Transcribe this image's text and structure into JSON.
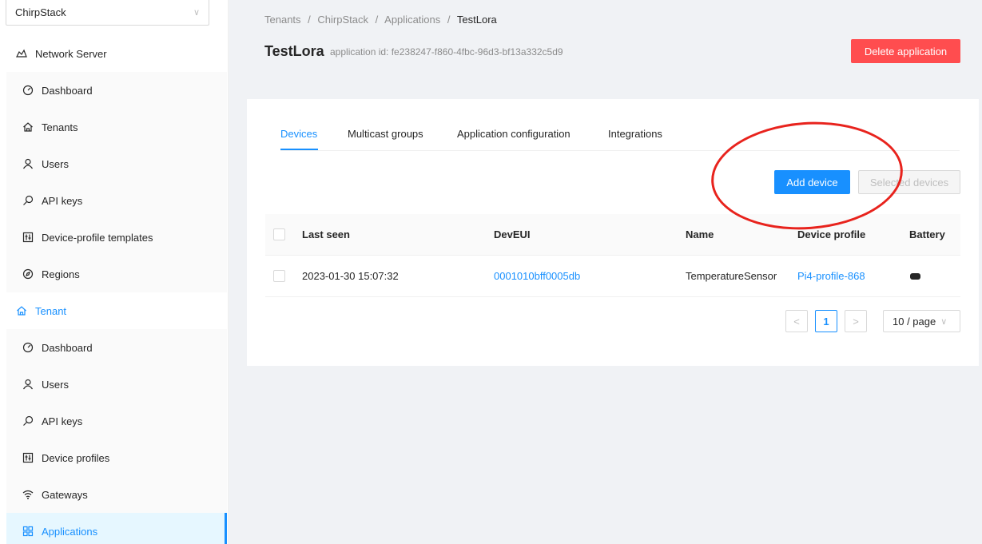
{
  "sidebar": {
    "tenant_select": {
      "value": "ChirpStack"
    },
    "network_server": {
      "label": "Network Server",
      "items": [
        {
          "label": "Dashboard",
          "icon": "dashboard-icon"
        },
        {
          "label": "Tenants",
          "icon": "home-icon"
        },
        {
          "label": "Users",
          "icon": "user-icon"
        },
        {
          "label": "API keys",
          "icon": "key-icon"
        },
        {
          "label": "Device-profile templates",
          "icon": "control-icon"
        },
        {
          "label": "Regions",
          "icon": "compass-icon"
        }
      ]
    },
    "tenant": {
      "label": "Tenant",
      "items": [
        {
          "label": "Dashboard",
          "icon": "dashboard-icon"
        },
        {
          "label": "Users",
          "icon": "user-icon"
        },
        {
          "label": "API keys",
          "icon": "key-icon"
        },
        {
          "label": "Device profiles",
          "icon": "control-icon"
        },
        {
          "label": "Gateways",
          "icon": "wifi-icon"
        },
        {
          "label": "Applications",
          "icon": "appstore-icon"
        }
      ]
    }
  },
  "breadcrumb": {
    "items": [
      "Tenants",
      "ChirpStack",
      "Applications"
    ],
    "current": "TestLora",
    "separator": "/"
  },
  "header": {
    "title": "TestLora",
    "subtitle": "application id: fe238247-f860-4fbc-96d3-bf13a332c5d9",
    "delete_label": "Delete application"
  },
  "tabs": [
    {
      "label": "Devices",
      "active": true
    },
    {
      "label": "Multicast groups",
      "active": false
    },
    {
      "label": "Application configuration",
      "active": false
    },
    {
      "label": "Integrations",
      "active": false
    }
  ],
  "actions": {
    "add_device_label": "Add device",
    "selected_devices_label": "Selected devices"
  },
  "table": {
    "columns": [
      "Last seen",
      "DevEUI",
      "Name",
      "Device profile",
      "Battery"
    ],
    "rows": [
      {
        "last_seen": "2023-01-30 15:07:32",
        "dev_eui": "0001010bff0005db",
        "name": "TemperatureSensor",
        "device_profile": "Pi4-profile-868",
        "battery": "battery-full-icon"
      }
    ]
  },
  "pagination": {
    "current_page": "1",
    "prev_icon": "<",
    "next_icon": ">",
    "page_size": "10 / page"
  },
  "colors": {
    "primary": "#1890ff",
    "danger": "#ff4d4f",
    "annotation": "#e8231d"
  }
}
